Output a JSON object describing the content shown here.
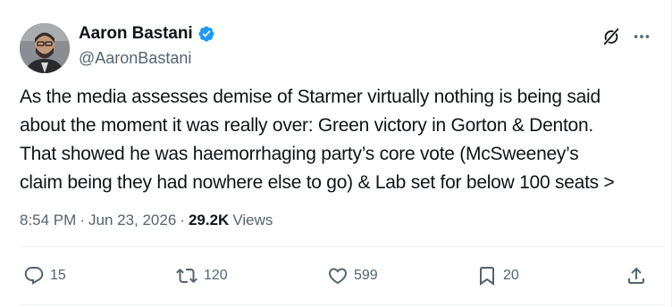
{
  "author": {
    "display_name": "Aaron Bastani",
    "handle": "@AaronBastani",
    "verified": true
  },
  "tweet": {
    "lines": [
      "As the media assesses demise of Starmer virtually nothing is being said",
      "about the moment it was really over: Green victory in Gorton & Denton.",
      "That showed he was haemorrhaging party’s core vote (McSweeney’s",
      "claim being they had nowhere else to go) & Lab set for below 100 seats >"
    ]
  },
  "meta": {
    "time": "8:54 PM",
    "separator": "·",
    "date": "Jun 23, 2026",
    "views_count": "29.2K",
    "views_label": "Views"
  },
  "actions": {
    "reply_count": "15",
    "retweet_count": "120",
    "like_count": "599",
    "bookmark_count": "20"
  },
  "icons": {
    "verified": "verified-badge-icon",
    "grok": "grok-icon",
    "more": "more-icon",
    "reply": "reply-icon",
    "retweet": "retweet-icon",
    "like": "heart-icon",
    "bookmark": "bookmark-icon",
    "share": "share-icon"
  },
  "colors": {
    "text": "#0f1419",
    "secondary": "#536471",
    "verified": "#1d9bf0",
    "divider": "#eff3f4"
  }
}
